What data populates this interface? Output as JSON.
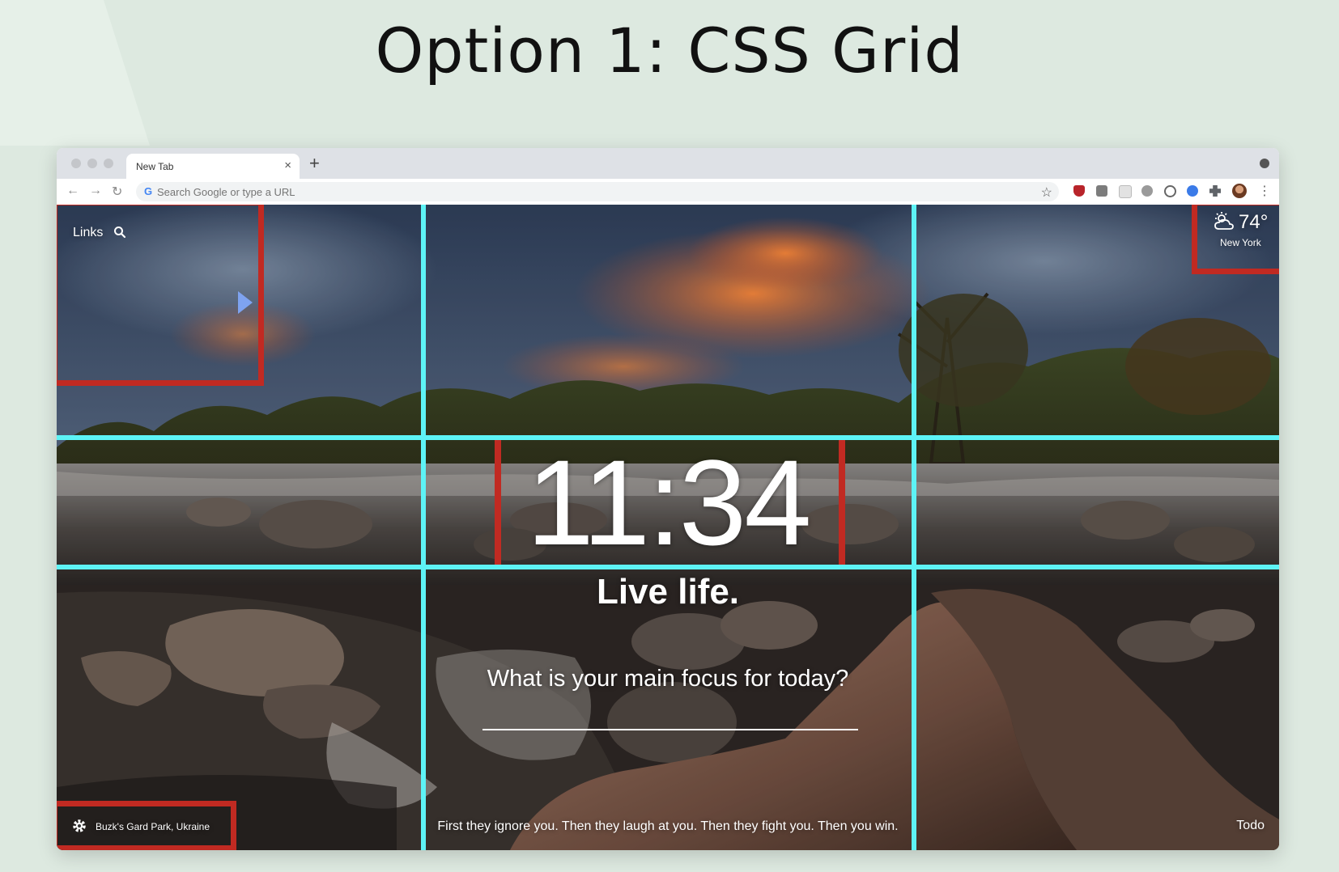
{
  "slide": {
    "title": "Option 1: CSS Grid"
  },
  "browser": {
    "tab_title": "New Tab",
    "tab_close": "×",
    "new_tab": "+",
    "omnibox_placeholder": "Search Google or type a URL",
    "back": "←",
    "forward": "→",
    "reload": "↻",
    "star": "☆",
    "google_g": "G",
    "menu": "⋮"
  },
  "dashboard": {
    "links_label": "Links",
    "weather": {
      "temperature": "74°",
      "location": "New York",
      "icon": "partly-cloudy-icon"
    },
    "clock": "11:34",
    "mantra": "Live life.",
    "focus_question": "What is your main focus for today?",
    "quote": "First they ignore you. Then they laugh at you. Then they fight you. Then you win.",
    "photo_location": "Buzk's Gard Park, Ukraine",
    "todo_label": "Todo"
  },
  "colors": {
    "grid_lines": "#5df3f6",
    "highlight_boxes": "#c12a22",
    "slide_background": "#dde9e0"
  }
}
